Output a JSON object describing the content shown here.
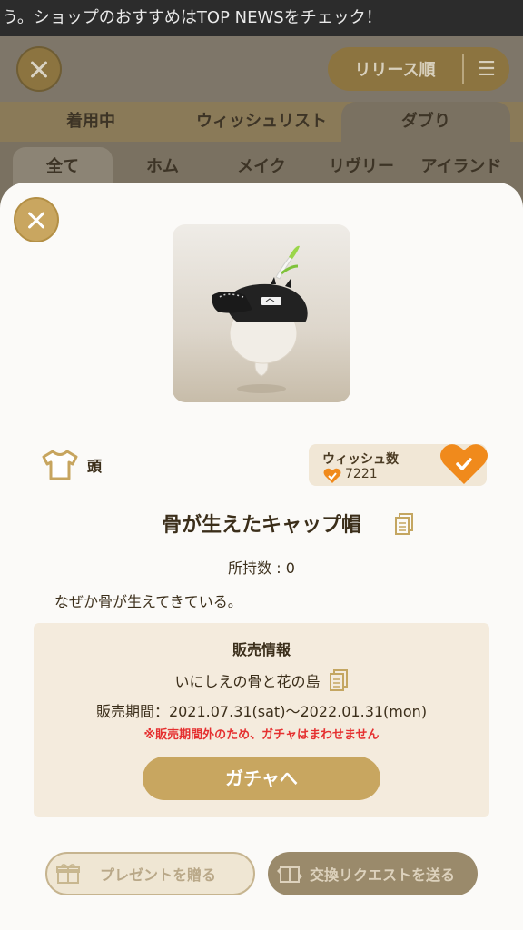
{
  "background": {
    "ticker_text": "う。ショップのおすすめはTOP NEWSをチェック！",
    "sort_label": "リリース順",
    "tabs": [
      "着用中",
      "ウィッシュリスト",
      "ダブり"
    ],
    "subtabs": [
      "全て",
      "ホム",
      "メイク",
      "リヴリー",
      "アイランド"
    ]
  },
  "item": {
    "category": "頭",
    "wish_label": "ウィッシュ数",
    "wish_count": "7221",
    "name": "骨が生えたキャップ帽",
    "owned": "所持数 : 0",
    "description": "なぜか骨が生えてきている。"
  },
  "sale": {
    "heading": "販売情報",
    "place": "いにしえの骨と花の島",
    "period": "販売期間：2021.07.31(sat)〜2022.01.31(mon)",
    "warning": "※販売期間外のため、ガチャはまわせません",
    "gacha_button": "ガチャへ"
  },
  "actions": {
    "present": "プレゼントを贈る",
    "trade": "交換リクエストを送る"
  },
  "colors": {
    "accent_gold": "#c8a660",
    "heart_orange": "#f08a1c",
    "warning_red": "#e53030"
  }
}
